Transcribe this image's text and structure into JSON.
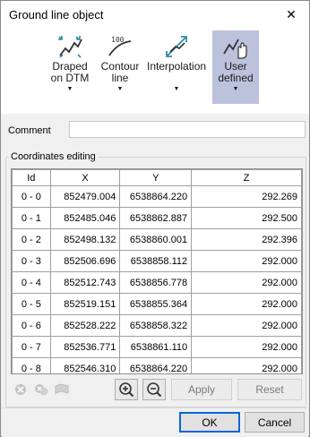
{
  "window": {
    "title": "Ground line object",
    "close_glyph": "✕"
  },
  "ribbon": {
    "buttons": [
      {
        "label": "Draped\non DTM",
        "icon": "draped-icon",
        "active": false
      },
      {
        "label": "Contour\nline",
        "icon": "contour-icon",
        "active": false
      },
      {
        "label": "Interpolation",
        "icon": "interpolation-icon",
        "active": false
      },
      {
        "label": "User\ndefined",
        "icon": "user-defined-icon",
        "active": true
      }
    ],
    "dropdown_glyph": "▼"
  },
  "comment": {
    "label": "Comment",
    "value": ""
  },
  "coordinates": {
    "group_label": "Coordinates editing",
    "columns": [
      "Id",
      "X",
      "Y",
      "Z"
    ],
    "rows": [
      [
        "0 - 0",
        "852479.004",
        "6538864.220",
        "292.269"
      ],
      [
        "0 - 1",
        "852485.046",
        "6538862.887",
        "292.500"
      ],
      [
        "0 - 2",
        "852498.132",
        "6538860.001",
        "292.396"
      ],
      [
        "0 - 3",
        "852506.696",
        "6538858.112",
        "292.000"
      ],
      [
        "0 - 4",
        "852512.743",
        "6538856.778",
        "292.000"
      ],
      [
        "0 - 5",
        "852519.151",
        "6538855.364",
        "292.000"
      ],
      [
        "0 - 6",
        "852528.222",
        "6538858.322",
        "292.000"
      ],
      [
        "0 - 7",
        "852536.771",
        "6538861.110",
        "292.000"
      ],
      [
        "0 - 8",
        "852546.310",
        "6538864.220",
        "292.000"
      ]
    ]
  },
  "actions": {
    "apply": "Apply",
    "reset": "Reset"
  },
  "footer": {
    "ok": "OK",
    "cancel": "Cancel"
  },
  "colors": {
    "accent": "#0a64d8",
    "active_ribbon": "#bcc2dc",
    "icon_teal": "#2f8aa8"
  }
}
